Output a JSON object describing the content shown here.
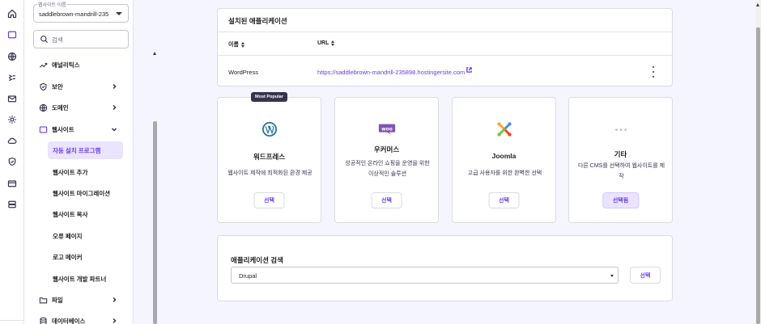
{
  "rail": {
    "icons": [
      "home-icon",
      "website-icon",
      "globe-icon",
      "hosting-icon",
      "mail-icon",
      "settings-icon",
      "cloud-icon",
      "shield-icon",
      "billing-icon",
      "server-icon"
    ]
  },
  "sidebar": {
    "site_select": {
      "label": "웹사이트 이름",
      "value": "saddlebrown-mandrill-235"
    },
    "search": {
      "placeholder": "검색"
    },
    "items": [
      {
        "label": "애널리틱스",
        "icon": "analytics-icon",
        "has_chevron": false
      },
      {
        "label": "보안",
        "icon": "shield-icon",
        "has_chevron": true
      },
      {
        "label": "도메인",
        "icon": "globe-icon",
        "has_chevron": true
      },
      {
        "label": "웹사이트",
        "icon": "website-icon",
        "has_chevron": true,
        "expanded": true
      },
      {
        "label": "파일",
        "icon": "folder-icon",
        "has_chevron": true
      },
      {
        "label": "데이터베이스",
        "icon": "database-icon",
        "has_chevron": true
      }
    ],
    "subitems": [
      {
        "label": "자동 설치 프로그램",
        "active": true
      },
      {
        "label": "웹사이트 추가"
      },
      {
        "label": "웹사이트 마이그레이션"
      },
      {
        "label": "웹사이트 복사"
      },
      {
        "label": "오류 페이지"
      },
      {
        "label": "로고 메이커"
      },
      {
        "label": "웹사이트 개발 파트너"
      }
    ]
  },
  "installed": {
    "title": "설치된 애플리케이션",
    "columns": [
      "이름",
      "URL"
    ],
    "rows": [
      {
        "name": "WordPress",
        "url": "https://saddlebrown-mandrill-235898.hostingersite.com"
      }
    ]
  },
  "apps": [
    {
      "name": "워드프레스",
      "desc": "웹사이트 제작에 최적화된 환경 제공",
      "button": "선택",
      "badge": "Most Popular",
      "icon": "wordpress-icon",
      "color": "#21759b"
    },
    {
      "name": "우커머스",
      "desc": "성공적인 온라인 쇼핑을 운영을 위한 이상적인 솔루션",
      "button": "선택",
      "icon": "woocommerce-icon",
      "color": "#7f54b3"
    },
    {
      "name": "Joomla",
      "desc": "고급 사용자를 위한 완벽한 선택",
      "button": "선택",
      "icon": "joomla-icon"
    },
    {
      "name": "기타",
      "desc": "다른 CMS를 선택하여 웹사이트를 제작",
      "button": "선택됨",
      "icon": "more-icon",
      "selected": true
    }
  ],
  "app_search": {
    "title": "애플리케이션 검색",
    "selected": "Drupal",
    "button": "선택"
  },
  "colors": {
    "accent": "#673de6",
    "accent_light": "#ebe4ff",
    "background": "#f4f5ff"
  }
}
